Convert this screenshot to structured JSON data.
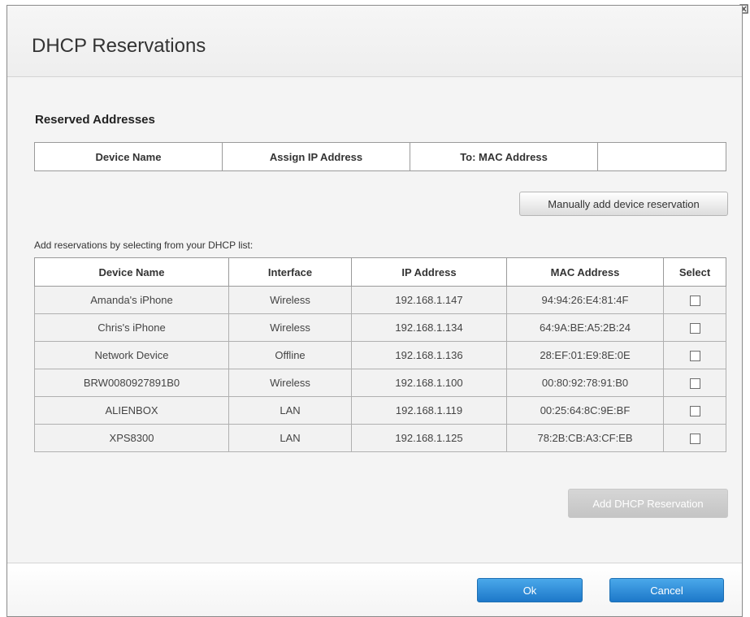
{
  "dialog": {
    "title": "DHCP Reservations",
    "close_icon": "close-icon"
  },
  "reserved": {
    "section_title": "Reserved Addresses",
    "headers": [
      "Device Name",
      "Assign IP Address",
      "To: MAC Address",
      ""
    ]
  },
  "manual_button_label": "Manually add device reservation",
  "dhcp_list": {
    "hint": "Add reservations by selecting from your DHCP list:",
    "headers": [
      "Device Name",
      "Interface",
      "IP Address",
      "MAC Address",
      "Select"
    ],
    "rows": [
      {
        "device": "Amanda's iPhone",
        "interface": "Wireless",
        "ip": "192.168.1.147",
        "mac": "94:94:26:E4:81:4F",
        "selected": false
      },
      {
        "device": "Chris's iPhone",
        "interface": "Wireless",
        "ip": "192.168.1.134",
        "mac": "64:9A:BE:A5:2B:24",
        "selected": false
      },
      {
        "device": "Network Device",
        "interface": "Offline",
        "ip": "192.168.1.136",
        "mac": "28:EF:01:E9:8E:0E",
        "selected": false
      },
      {
        "device": "BRW0080927891B0",
        "interface": "Wireless",
        "ip": "192.168.1.100",
        "mac": "00:80:92:78:91:B0",
        "selected": false
      },
      {
        "device": "ALIENBOX",
        "interface": "LAN",
        "ip": "192.168.1.119",
        "mac": "00:25:64:8C:9E:BF",
        "selected": false
      },
      {
        "device": "XPS8300",
        "interface": "LAN",
        "ip": "192.168.1.125",
        "mac": "78:2B:CB:A3:CF:EB",
        "selected": false
      }
    ]
  },
  "add_button_label": "Add DHCP Reservation",
  "footer": {
    "ok_label": "Ok",
    "cancel_label": "Cancel"
  },
  "colors": {
    "primary_button": "#1d78c9",
    "disabled_button": "#c4c4c4",
    "body_background": "#f4f4f4"
  }
}
